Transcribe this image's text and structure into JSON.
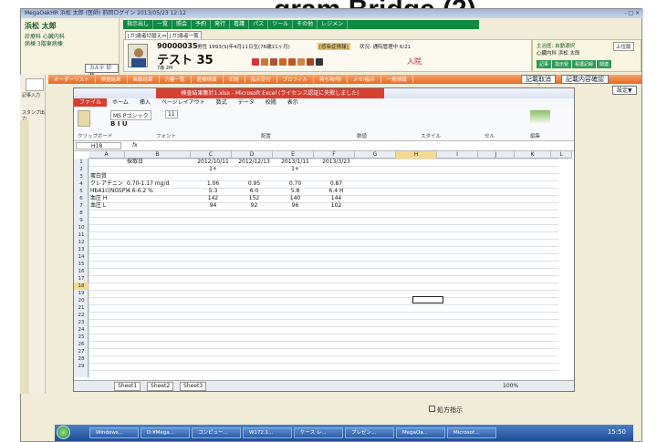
{
  "slide": {
    "title_fragment": "gram Bridge (2)"
  },
  "app": {
    "title": "MegaOakHR 浜松 太郎 (医師) 前回ログイン 2013/05/23 12:12",
    "user_name": "浜松 太郎",
    "dept1": "診療科 心臓内科",
    "dept2": "病棟 3階東病棟",
    "chart_switch": "カルテ 切替",
    "window_controls": "- □ ×"
  },
  "top_menu": [
    "指示出し",
    "一覧",
    "照会",
    "予約",
    "発行",
    "看護",
    "パス",
    "ツール",
    "その他",
    "レジメン"
  ],
  "tabs2": [
    "[ガ]患者切替えm",
    "[ガ]患者一覧"
  ],
  "patient": {
    "id": "90000035",
    "name": "テスト 35",
    "age": "7歳 2M",
    "info": "男性 1993(S)年4月11日生(76歳11ヶ月)",
    "inpatient": "入院",
    "allergy": "[感染症情報]",
    "status_label": "状況: 通院管理中 6/21",
    "icons": "2 3 8 2 2 2 2 2 2"
  },
  "right_panel": {
    "line1": "主治医: 自動選択",
    "line2": "心臓内科  浜松 太郎",
    "tabs": [
      "記事",
      "指示受",
      "看護記録",
      "関連"
    ],
    "extra": "上位版"
  },
  "orange_bar": [
    "オーダーリスト",
    "検査結果",
    "画像結果",
    "力量一覧",
    "医療情報",
    "印刷",
    "指示受付",
    "プロフィル",
    "持ち物/物",
    "メモ/指示",
    "一般情報"
  ],
  "orange_right": {
    "cancel": "記載取消",
    "confirm": "記載内容確認",
    "settings": "設定▼"
  },
  "sidebar": {
    "item1": "記事入力",
    "item2": "スタンプ出力"
  },
  "excel": {
    "title": "検査結果集計1.xlsx - Microsoft Excel (ライセンス認証に失敗しました)",
    "tabs": [
      "ファイル",
      "ホーム",
      "挿入",
      "ページレイアウト",
      "数式",
      "データ",
      "校閲",
      "表示"
    ],
    "font": "MS Pゴシック",
    "size": "11",
    "groups": [
      "クリップボード",
      "フォント",
      "配置",
      "数値",
      "スタイル",
      "セル",
      "編集"
    ],
    "namebox": "H18",
    "formula": "fx",
    "columns": [
      "A",
      "B",
      "C",
      "D",
      "E",
      "F",
      "G",
      "H",
      "I",
      "J",
      "K",
      "L"
    ],
    "rows": [
      [
        "",
        "採取日",
        "2012/10/11",
        "2012/12/13",
        "2013/1/11",
        "2013/3/23"
      ],
      [
        "",
        "",
        "1+",
        "",
        "1+",
        ""
      ],
      [
        "蛋白質",
        "",
        "",
        "",
        "",
        ""
      ],
      [
        "クレアチニン",
        "0.70-1.17 mg/d",
        "1.06",
        "0.95",
        "0.70",
        "0.87"
      ],
      [
        "HbA1c(NGSP)",
        "4.6-6.2 %",
        "5.3",
        "6.0",
        "5.8",
        "6.4 H"
      ],
      [
        "血圧 H",
        "",
        "142",
        "152",
        "140",
        "144"
      ],
      [
        "血圧 L",
        "",
        "94",
        "92",
        "96",
        "102"
      ]
    ],
    "row_numbers": [
      "1",
      "2",
      "3",
      "4",
      "5",
      "6",
      "7",
      "8",
      "9",
      "10",
      "11",
      "12",
      "13",
      "14",
      "15",
      "16",
      "17",
      "18",
      "19",
      "20",
      "21",
      "22",
      "23",
      "24",
      "25",
      "26",
      "27",
      "28",
      "29"
    ],
    "sheets": [
      "Sheet1",
      "Sheet2",
      "Sheet3"
    ],
    "zoom": "100%"
  },
  "bottom": {
    "prescription": "処方指示"
  },
  "taskbar": {
    "items": [
      "Windows...",
      "D:¥Mega...",
      "コンピュー...",
      "W172.1...",
      "ケース レ...",
      "プレゼン...",
      "MegaOa...",
      "Microsof..."
    ],
    "clock": "15:50"
  }
}
